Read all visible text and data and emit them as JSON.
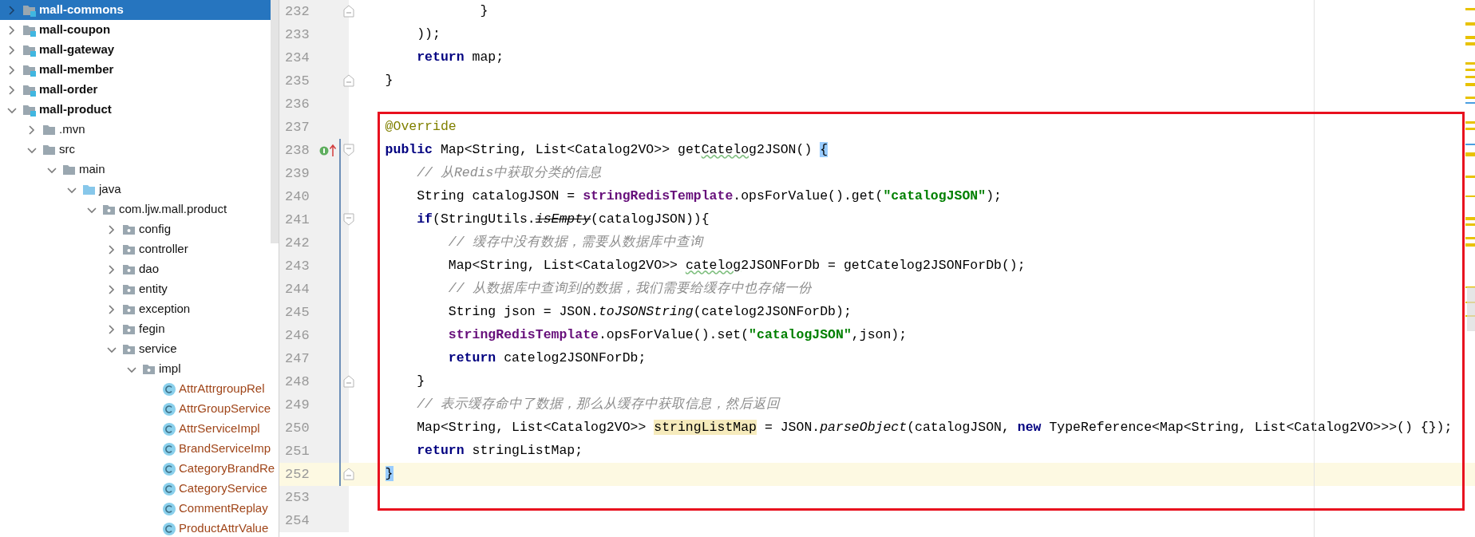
{
  "project_tree": [
    {
      "label": "mall-commons",
      "kind": "module",
      "expanded": false,
      "selected": true
    },
    {
      "label": "mall-coupon",
      "kind": "module",
      "expanded": false,
      "selected": false
    },
    {
      "label": "mall-gateway",
      "kind": "module",
      "expanded": false,
      "selected": false
    },
    {
      "label": "mall-member",
      "kind": "module",
      "expanded": false,
      "selected": false
    },
    {
      "label": "mall-order",
      "kind": "module",
      "expanded": false,
      "selected": false
    },
    {
      "label": "mall-product",
      "kind": "module",
      "expanded": true,
      "selected": false,
      "children": [
        {
          "label": ".mvn",
          "kind": "folder",
          "expanded": false,
          "selected": false
        },
        {
          "label": "src",
          "kind": "folder",
          "expanded": true,
          "selected": false,
          "children": [
            {
              "label": "main",
              "kind": "folder",
              "expanded": true,
              "selected": false,
              "children": [
                {
                  "label": "java",
                  "kind": "source",
                  "expanded": true,
                  "selected": false,
                  "children": [
                    {
                      "label": "com.ljw.mall.product",
                      "kind": "package",
                      "expanded": true,
                      "selected": false,
                      "children": [
                        {
                          "label": "config",
                          "kind": "package",
                          "expanded": false,
                          "selected": false
                        },
                        {
                          "label": "controller",
                          "kind": "package",
                          "expanded": false,
                          "selected": false
                        },
                        {
                          "label": "dao",
                          "kind": "package",
                          "expanded": false,
                          "selected": false
                        },
                        {
                          "label": "entity",
                          "kind": "package",
                          "expanded": false,
                          "selected": false
                        },
                        {
                          "label": "exception",
                          "kind": "package",
                          "expanded": false,
                          "selected": false
                        },
                        {
                          "label": "fegin",
                          "kind": "package",
                          "expanded": false,
                          "selected": false
                        },
                        {
                          "label": "service",
                          "kind": "package",
                          "expanded": true,
                          "selected": false,
                          "children": [
                            {
                              "label": "impl",
                              "kind": "package",
                              "expanded": true,
                              "selected": false,
                              "children": [
                                {
                                  "label": "AttrAttrgroupRel",
                                  "kind": "class",
                                  "selected": false
                                },
                                {
                                  "label": "AttrGroupService",
                                  "kind": "class",
                                  "selected": false
                                },
                                {
                                  "label": "AttrServiceImpl",
                                  "kind": "class",
                                  "selected": false
                                },
                                {
                                  "label": "BrandServiceImp",
                                  "kind": "class",
                                  "selected": false
                                },
                                {
                                  "label": "CategoryBrandRe",
                                  "kind": "class",
                                  "selected": false
                                },
                                {
                                  "label": "CategoryService",
                                  "kind": "class",
                                  "selected": false
                                },
                                {
                                  "label": "CommentReplay",
                                  "kind": "class",
                                  "selected": false
                                },
                                {
                                  "label": "ProductAttrValue",
                                  "kind": "class",
                                  "selected": false
                                }
                              ]
                            }
                          ]
                        }
                      ]
                    }
                  ]
                }
              ]
            }
          ]
        }
      ]
    }
  ],
  "editor": {
    "lines": [
      {
        "number": "232",
        "fold_start": false,
        "fold_end": true,
        "implements_marker": false,
        "current": false,
        "tokens": [
          {
            "kind": "plain",
            "text": "                }"
          }
        ]
      },
      {
        "number": "233",
        "fold_start": false,
        "fold_end": false,
        "implements_marker": false,
        "current": false,
        "tokens": [
          {
            "kind": "plain",
            "text": "        ));"
          }
        ]
      },
      {
        "number": "234",
        "fold_start": false,
        "fold_end": false,
        "implements_marker": false,
        "current": false,
        "tokens": [
          {
            "kind": "keyword",
            "text": "        return"
          },
          {
            "kind": "plain",
            "text": " map;"
          }
        ]
      },
      {
        "number": "235",
        "fold_start": false,
        "fold_end": true,
        "implements_marker": false,
        "current": false,
        "tokens": [
          {
            "kind": "plain",
            "text": "    }"
          }
        ]
      },
      {
        "number": "236",
        "fold_start": false,
        "fold_end": false,
        "implements_marker": false,
        "current": false
      },
      {
        "number": "237",
        "fold_start": false,
        "fold_end": false,
        "implements_marker": false,
        "current": false,
        "tokens": [
          {
            "kind": "annotation",
            "text": "    @Override"
          }
        ]
      },
      {
        "number": "238",
        "fold_start": true,
        "fold_end": false,
        "implements_marker": true,
        "current": false,
        "tokens": [
          {
            "kind": "keyword",
            "text": "    public"
          },
          {
            "kind": "plain",
            "text": " Map<String, List<Catalog2VO>> get"
          },
          {
            "kind": "typo",
            "text": "Catelog"
          },
          {
            "kind": "plain",
            "text": "2JSON() "
          },
          {
            "kind": "bracket",
            "text": "{"
          }
        ]
      },
      {
        "number": "239",
        "fold_start": false,
        "fold_end": false,
        "implements_marker": false,
        "current": false,
        "tokens": [
          {
            "kind": "comment",
            "text": "        // 从Redis中获取分类的信息"
          }
        ]
      },
      {
        "number": "240",
        "fold_start": false,
        "fold_end": false,
        "implements_marker": false,
        "current": false,
        "tokens": [
          {
            "kind": "plain",
            "text": "        String catalogJSON = "
          },
          {
            "kind": "field",
            "text": "stringRedisTemplate"
          },
          {
            "kind": "plain",
            "text": ".opsForValue().get("
          },
          {
            "kind": "string",
            "text": "\"catalogJSON\""
          },
          {
            "kind": "plain",
            "text": ");"
          }
        ]
      },
      {
        "number": "241",
        "fold_start": true,
        "fold_end": false,
        "implements_marker": false,
        "current": false,
        "tokens": [
          {
            "kind": "keyword",
            "text": "        if"
          },
          {
            "kind": "plain",
            "text": "(StringUtils."
          },
          {
            "kind": "deprecated",
            "text": "isEmpty"
          },
          {
            "kind": "plain",
            "text": "(catalogJSON)){"
          }
        ]
      },
      {
        "number": "242",
        "fold_start": false,
        "fold_end": false,
        "implements_marker": false,
        "current": false,
        "tokens": [
          {
            "kind": "comment",
            "text": "            // 缓存中没有数据，需要从数据库中查询"
          }
        ]
      },
      {
        "number": "243",
        "fold_start": false,
        "fold_end": false,
        "implements_marker": false,
        "current": false,
        "tokens": [
          {
            "kind": "plain",
            "text": "            Map<String, List<Catalog2VO>> "
          },
          {
            "kind": "typo",
            "text": "catelog"
          },
          {
            "kind": "plain",
            "text": "2JSONForDb = getCatelog2JSONForDb();"
          }
        ]
      },
      {
        "number": "244",
        "fold_start": false,
        "fold_end": false,
        "implements_marker": false,
        "current": false,
        "tokens": [
          {
            "kind": "comment",
            "text": "            // 从数据库中查询到的数据，我们需要给缓存中也存储一份"
          }
        ]
      },
      {
        "number": "245",
        "fold_start": false,
        "fold_end": false,
        "implements_marker": false,
        "current": false,
        "tokens": [
          {
            "kind": "plain",
            "text": "            String json = JSON."
          },
          {
            "kind": "static",
            "text": "toJSONString"
          },
          {
            "kind": "plain",
            "text": "(catelog2JSONForDb);"
          }
        ]
      },
      {
        "number": "246",
        "fold_start": false,
        "fold_end": false,
        "implements_marker": false,
        "current": false,
        "tokens": [
          {
            "kind": "field",
            "text": "            stringRedisTemplate"
          },
          {
            "kind": "plain",
            "text": ".opsForValue().set("
          },
          {
            "kind": "string",
            "text": "\"catalogJSON\""
          },
          {
            "kind": "plain",
            "text": ",json);"
          }
        ]
      },
      {
        "number": "247",
        "fold_start": false,
        "fold_end": false,
        "implements_marker": false,
        "current": false,
        "tokens": [
          {
            "kind": "keyword",
            "text": "            return"
          },
          {
            "kind": "plain",
            "text": " catelog2JSONForDb;"
          }
        ]
      },
      {
        "number": "248",
        "fold_start": false,
        "fold_end": true,
        "implements_marker": false,
        "current": false,
        "tokens": [
          {
            "kind": "plain",
            "text": "        }"
          }
        ]
      },
      {
        "number": "249",
        "fold_start": false,
        "fold_end": false,
        "implements_marker": false,
        "current": false,
        "tokens": [
          {
            "kind": "comment",
            "text": "        // 表示缓存命中了数据，那么从缓存中获取信息，然后返回"
          }
        ]
      },
      {
        "number": "250",
        "fold_start": false,
        "fold_end": false,
        "implements_marker": false,
        "current": false,
        "tokens": [
          {
            "kind": "plain",
            "text": "        Map<String, List<Catalog2VO>> "
          },
          {
            "kind": "usage",
            "text": "stringListMap"
          },
          {
            "kind": "plain",
            "text": " = JSON."
          },
          {
            "kind": "static",
            "text": "parseObject"
          },
          {
            "kind": "plain",
            "text": "(catalogJSON, "
          },
          {
            "kind": "keyword",
            "text": "new"
          },
          {
            "kind": "plain",
            "text": " TypeReference<Map<String, List<Catalog2VO>>>() {});"
          }
        ]
      },
      {
        "number": "251",
        "fold_start": false,
        "fold_end": false,
        "implements_marker": false,
        "current": false,
        "tokens": [
          {
            "kind": "keyword",
            "text": "        return"
          },
          {
            "kind": "plain",
            "text": " stringListMap;"
          }
        ]
      },
      {
        "number": "252",
        "fold_start": false,
        "fold_end": true,
        "implements_marker": false,
        "current": true,
        "tokens": [
          {
            "kind": "bracket",
            "text": "    }"
          }
        ]
      },
      {
        "number": "253",
        "fold_start": false,
        "fold_end": false,
        "implements_marker": false,
        "current": false
      },
      {
        "number": "254",
        "fold_start": false,
        "fold_end": false,
        "implements_marker": false,
        "current": false
      }
    ]
  }
}
